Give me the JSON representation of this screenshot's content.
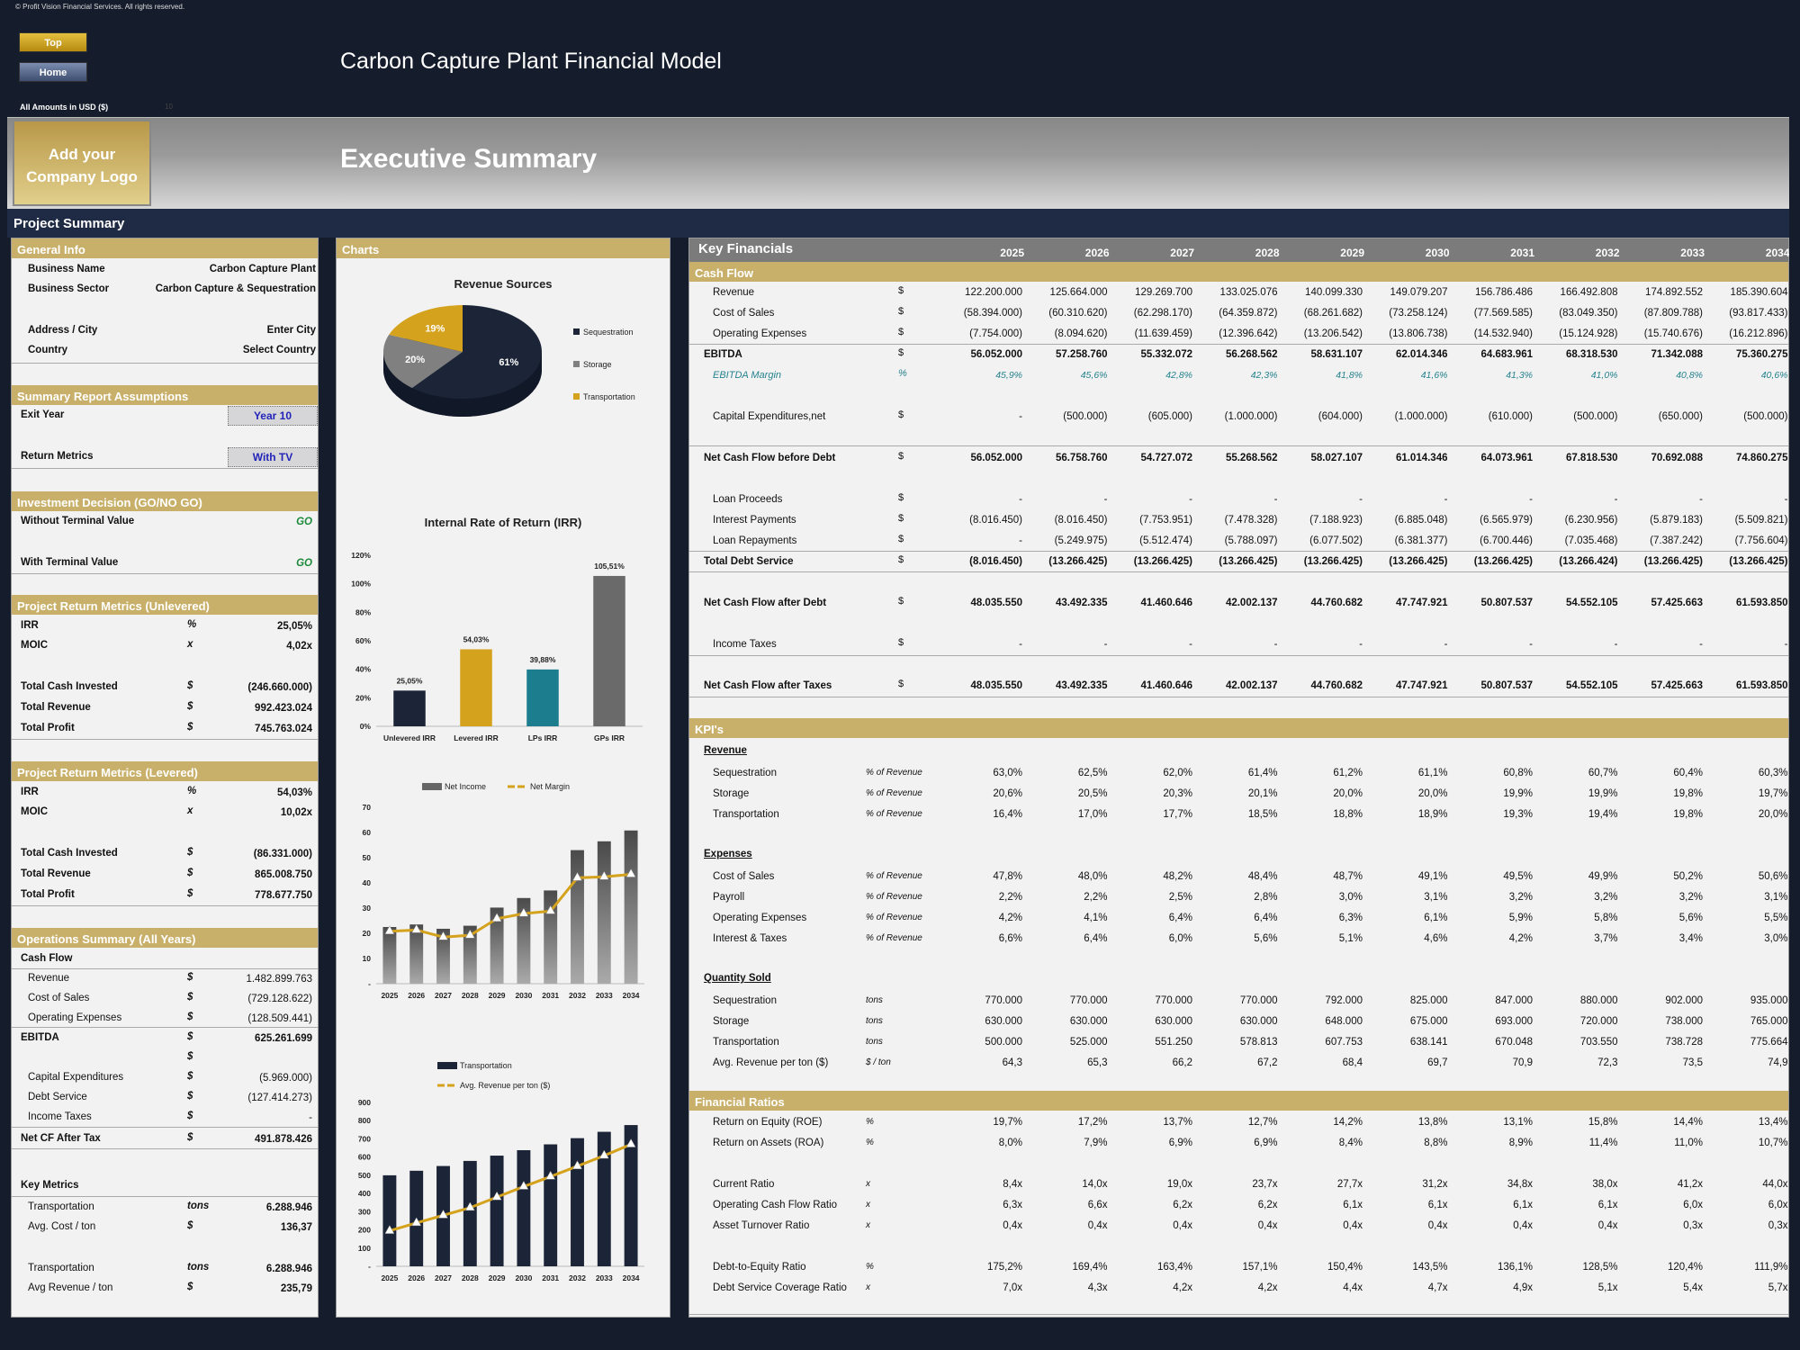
{
  "copyright": "© Profit Vision Financial Services. All rights reserved.",
  "nav": {
    "top_label": "Top",
    "home_label": "Home"
  },
  "app_title": "Carbon Capture Plant Financial Model",
  "amounts_label": "All Amounts in   USD ($)",
  "amounts_faint": "10",
  "logo_text": "Add your Company Logo",
  "page_title": "Executive Summary",
  "project_summary_label": "Project Summary",
  "general_info": {
    "title": "General Info",
    "rows": [
      {
        "label": "Business Name",
        "value": "Carbon Capture Plant"
      },
      {
        "label": "Business Sector",
        "value": "Carbon Capture & Sequestration"
      },
      {
        "label": "Address / City",
        "value": "Enter City"
      },
      {
        "label": "Country",
        "value": "Select Country"
      }
    ]
  },
  "assumptions": {
    "title": "Summary  Report Assumptions",
    "exit_year_label": "Exit Year",
    "exit_year_value": "Year 10",
    "return_metrics_label": "Return Metrics",
    "return_metrics_value": "With TV"
  },
  "investment_decision": {
    "title": "Investment Decision (GO/NO GO)",
    "without_tv_label": "Without Terminal Value",
    "without_tv_value": "GO",
    "with_tv_label": "With Terminal Value",
    "with_tv_value": "GO"
  },
  "unlevered": {
    "title": "Project Return Metrics (Unlevered)",
    "rows": [
      {
        "label": "IRR",
        "unit": "%",
        "value": "25,05%"
      },
      {
        "label": "MOIC",
        "unit": "x",
        "value": "4,02x"
      },
      {
        "label": "Total Cash Invested",
        "unit": "$",
        "value": "(246.660.000)"
      },
      {
        "label": "Total Revenue",
        "unit": "$",
        "value": "992.423.024"
      },
      {
        "label": "Total Profit",
        "unit": "$",
        "value": "745.763.024"
      }
    ]
  },
  "levered": {
    "title": "Project Return Metrics (Levered)",
    "rows": [
      {
        "label": "IRR",
        "unit": "%",
        "value": "54,03%"
      },
      {
        "label": "MOIC",
        "unit": "x",
        "value": "10,02x"
      },
      {
        "label": "Total Cash Invested",
        "unit": "$",
        "value": "(86.331.000)"
      },
      {
        "label": "Total Revenue",
        "unit": "$",
        "value": "865.008.750"
      },
      {
        "label": "Total Profit",
        "unit": "$",
        "value": "778.677.750"
      }
    ]
  },
  "operations": {
    "title": "Operations Summary (All Years)",
    "cash_flow_label": "Cash Flow",
    "rows": [
      {
        "label": "Revenue",
        "unit": "$",
        "value": "1.482.899.763"
      },
      {
        "label": "Cost of Sales",
        "unit": "$",
        "value": "(729.128.622)"
      },
      {
        "label": "Operating Expenses",
        "unit": "$",
        "value": "(128.509.441)"
      },
      {
        "label": "EBITDA",
        "unit": "$",
        "value": "625.261.699"
      },
      {
        "label": "",
        "unit": "$",
        "value": ""
      },
      {
        "label": "Capital Expenditures",
        "unit": "$",
        "value": "(5.969.000)"
      },
      {
        "label": "Debt Service",
        "unit": "$",
        "value": "(127.414.273)"
      },
      {
        "label": "Income Taxes",
        "unit": "$",
        "value": "-"
      },
      {
        "label": "Net CF After Tax",
        "unit": "$",
        "value": "491.878.426"
      }
    ],
    "key_metrics_label": "Key Metrics",
    "key_metrics": [
      {
        "label": "Transportation",
        "unit": "tons",
        "value": "6.288.946"
      },
      {
        "label": "Avg. Cost / ton",
        "unit": "$",
        "value": "136,37"
      },
      {
        "label": "Transportation",
        "unit": "tons",
        "value": "6.288.946"
      },
      {
        "label": "Avg Revenue / ton",
        "unit": "$",
        "value": "235,79"
      }
    ]
  },
  "charts_title": "Charts",
  "chart_data": [
    {
      "type": "pie",
      "title": "Revenue Sources",
      "categories": [
        "Sequestration",
        "Storage",
        "Transportation"
      ],
      "values": [
        61,
        20,
        19
      ],
      "labels": [
        "61%",
        "20%",
        "19%"
      ],
      "colors": [
        "#1c2537",
        "#808080",
        "#d4a21c"
      ],
      "legend": "right"
    },
    {
      "type": "bar",
      "title": "Internal Rate of Return (IRR)",
      "categories": [
        "Unlevered IRR",
        "Levered IRR",
        "LPs IRR",
        "GPs IRR"
      ],
      "values": [
        25.05,
        54.03,
        39.88,
        105.51
      ],
      "labels": [
        "25,05%",
        "54,03%",
        "39,88%",
        "105,51%"
      ],
      "colors": [
        "#1c2537",
        "#d4a21c",
        "#1b7d8e",
        "#6a6a6a"
      ],
      "ylim": [
        0,
        120
      ],
      "yticks": [
        "0%",
        "20%",
        "40%",
        "60%",
        "80%",
        "100%",
        "120%"
      ]
    },
    {
      "type": "bar+line",
      "title": "",
      "categories": [
        "2025",
        "2026",
        "2027",
        "2028",
        "2029",
        "2030",
        "2031",
        "2032",
        "2033",
        "2034"
      ],
      "series": [
        {
          "name": "Net Income",
          "type": "bar",
          "values": [
            22.5,
            23.5,
            21.8,
            23.0,
            30.2,
            34.0,
            37.0,
            53.0,
            56.5,
            60.8
          ]
        },
        {
          "name": "Net Margin",
          "type": "line",
          "values": [
            20.8,
            21.3,
            18.5,
            19.2,
            25.8,
            27.8,
            28.8,
            42.0,
            42.4,
            43.4
          ]
        }
      ],
      "ylim": [
        0,
        70
      ],
      "yticks": [
        "-",
        "10",
        "20",
        "30",
        "40",
        "50",
        "60",
        "70"
      ],
      "legend": "top"
    },
    {
      "type": "bar+line",
      "title": "",
      "categories": [
        "2025",
        "2026",
        "2027",
        "2028",
        "2029",
        "2030",
        "2031",
        "2032",
        "2033",
        "2034"
      ],
      "series": [
        {
          "name": "Transportation",
          "type": "bar",
          "values": [
            500,
            525,
            551,
            579,
            608,
            638,
            670,
            704,
            739,
            776
          ]
        },
        {
          "name": "Avg. Revenue per ton ($)",
          "type": "line",
          "values": [
            195,
            238,
            280,
            322,
            380,
            438,
            493,
            550,
            608,
            670
          ]
        }
      ],
      "ylim": [
        0,
        900
      ],
      "yticks": [
        "-",
        "100",
        "200",
        "300",
        "400",
        "500",
        "600",
        "700",
        "800",
        "900"
      ],
      "legend": "top"
    }
  ],
  "key_financials": {
    "title": "Key Financials",
    "years": [
      "2025",
      "2026",
      "2027",
      "2028",
      "2029",
      "2030",
      "2031",
      "2032",
      "2033",
      "2034"
    ],
    "cash_flow_title": "Cash Flow",
    "cash_flow_rows": [
      {
        "label": "Revenue",
        "unit": "$",
        "style": "ind",
        "values": [
          "122.200.000",
          "125.664.000",
          "129.269.700",
          "133.025.076",
          "140.099.330",
          "149.079.207",
          "156.786.486",
          "166.492.808",
          "174.892.552",
          "185.390.604"
        ]
      },
      {
        "label": "Cost of Sales",
        "unit": "$",
        "style": "ind",
        "values": [
          "(58.394.000)",
          "(60.310.620)",
          "(62.298.170)",
          "(64.359.872)",
          "(68.261.682)",
          "(73.258.124)",
          "(77.569.585)",
          "(83.049.350)",
          "(87.809.788)",
          "(93.817.433)"
        ]
      },
      {
        "label": "Operating Expenses",
        "unit": "$",
        "style": "ind",
        "values": [
          "(7.754.000)",
          "(8.094.620)",
          "(11.639.459)",
          "(12.396.642)",
          "(13.206.542)",
          "(13.806.738)",
          "(14.532.940)",
          "(15.124.928)",
          "(15.740.676)",
          "(16.212.896)"
        ]
      },
      {
        "label": "EBITDA",
        "unit": "$",
        "style": "bold",
        "values": [
          "56.052.000",
          "57.258.760",
          "55.332.072",
          "56.268.562",
          "58.631.107",
          "62.014.346",
          "64.683.961",
          "68.318.530",
          "71.342.088",
          "75.360.275"
        ]
      },
      {
        "label": "EBITDA Margin",
        "unit": "%",
        "style": "margin",
        "values": [
          "45,9%",
          "45,6%",
          "42,8%",
          "42,3%",
          "41,8%",
          "41,6%",
          "41,3%",
          "41,0%",
          "40,8%",
          "40,6%"
        ]
      },
      {
        "label": "Capital Expenditures,net",
        "unit": "$",
        "style": "ind",
        "values": [
          "-",
          "(500.000)",
          "(605.000)",
          "(1.000.000)",
          "(604.000)",
          "(1.000.000)",
          "(610.000)",
          "(500.000)",
          "(650.000)",
          "(500.000)"
        ]
      },
      {
        "label": "Net Cash Flow before Debt",
        "unit": "$",
        "style": "bold",
        "values": [
          "56.052.000",
          "56.758.760",
          "54.727.072",
          "55.268.562",
          "58.027.107",
          "61.014.346",
          "64.073.961",
          "67.818.530",
          "70.692.088",
          "74.860.275"
        ]
      },
      {
        "label": "Loan Proceeds",
        "unit": "$",
        "style": "ind",
        "values": [
          "-",
          "-",
          "-",
          "-",
          "-",
          "-",
          "-",
          "-",
          "-",
          "-"
        ]
      },
      {
        "label": "Interest Payments",
        "unit": "$",
        "style": "ind",
        "values": [
          "(8.016.450)",
          "(8.016.450)",
          "(7.753.951)",
          "(7.478.328)",
          "(7.188.923)",
          "(6.885.048)",
          "(6.565.979)",
          "(6.230.956)",
          "(5.879.183)",
          "(5.509.821)"
        ]
      },
      {
        "label": "Loan Repayments",
        "unit": "$",
        "style": "ind",
        "values": [
          "-",
          "(5.249.975)",
          "(5.512.474)",
          "(5.788.097)",
          "(6.077.502)",
          "(6.381.377)",
          "(6.700.446)",
          "(7.035.468)",
          "(7.387.242)",
          "(7.756.604)"
        ]
      },
      {
        "label": "Total Debt Service",
        "unit": "$",
        "style": "bold",
        "values": [
          "(8.016.450)",
          "(13.266.425)",
          "(13.266.425)",
          "(13.266.425)",
          "(13.266.425)",
          "(13.266.425)",
          "(13.266.425)",
          "(13.266.424)",
          "(13.266.425)",
          "(13.266.425)"
        ]
      },
      {
        "label": "Net Cash Flow after Debt",
        "unit": "$",
        "style": "bold",
        "values": [
          "48.035.550",
          "43.492.335",
          "41.460.646",
          "42.002.137",
          "44.760.682",
          "47.747.921",
          "50.807.537",
          "54.552.105",
          "57.425.663",
          "61.593.850"
        ]
      },
      {
        "label": "Income Taxes",
        "unit": "$",
        "style": "ind",
        "values": [
          "-",
          "-",
          "-",
          "-",
          "-",
          "-",
          "-",
          "-",
          "-",
          "-"
        ]
      },
      {
        "label": "Net Cash Flow after Taxes",
        "unit": "$",
        "style": "bold",
        "values": [
          "48.035.550",
          "43.492.335",
          "41.460.646",
          "42.002.137",
          "44.760.682",
          "47.747.921",
          "50.807.537",
          "54.552.105",
          "57.425.663",
          "61.593.850"
        ]
      }
    ],
    "kpi_title": "KPI's",
    "kpi_revenue_label": "Revenue",
    "kpi_revenue": [
      {
        "label": "Sequestration",
        "unit": "% of Revenue",
        "values": [
          "63,0%",
          "62,5%",
          "62,0%",
          "61,4%",
          "61,2%",
          "61,1%",
          "60,8%",
          "60,7%",
          "60,4%",
          "60,3%"
        ]
      },
      {
        "label": "Storage",
        "unit": "% of Revenue",
        "values": [
          "20,6%",
          "20,5%",
          "20,3%",
          "20,1%",
          "20,0%",
          "20,0%",
          "19,9%",
          "19,9%",
          "19,8%",
          "19,7%"
        ]
      },
      {
        "label": "Transportation",
        "unit": "% of Revenue",
        "values": [
          "16,4%",
          "17,0%",
          "17,7%",
          "18,5%",
          "18,8%",
          "18,9%",
          "19,3%",
          "19,4%",
          "19,8%",
          "20,0%"
        ]
      }
    ],
    "kpi_expenses_label": "Expenses",
    "kpi_expenses": [
      {
        "label": "Cost of Sales",
        "unit": "% of Revenue",
        "values": [
          "47,8%",
          "48,0%",
          "48,2%",
          "48,4%",
          "48,7%",
          "49,1%",
          "49,5%",
          "49,9%",
          "50,2%",
          "50,6%"
        ]
      },
      {
        "label": "Payroll",
        "unit": "% of Revenue",
        "values": [
          "2,2%",
          "2,2%",
          "2,5%",
          "2,8%",
          "3,0%",
          "3,1%",
          "3,2%",
          "3,2%",
          "3,2%",
          "3,1%"
        ]
      },
      {
        "label": "Operating Expenses",
        "unit": "% of Revenue",
        "values": [
          "4,2%",
          "4,1%",
          "6,4%",
          "6,4%",
          "6,3%",
          "6,1%",
          "5,9%",
          "5,8%",
          "5,6%",
          "5,5%"
        ]
      },
      {
        "label": "Interest & Taxes",
        "unit": "% of Revenue",
        "values": [
          "6,6%",
          "6,4%",
          "6,0%",
          "5,6%",
          "5,1%",
          "4,6%",
          "4,2%",
          "3,7%",
          "3,4%",
          "3,0%"
        ]
      }
    ],
    "kpi_quantity_label": "Quantity Sold",
    "kpi_quantity": [
      {
        "label": "Sequestration",
        "unit": "tons",
        "values": [
          "770.000",
          "770.000",
          "770.000",
          "770.000",
          "792.000",
          "825.000",
          "847.000",
          "880.000",
          "902.000",
          "935.000"
        ]
      },
      {
        "label": "Storage",
        "unit": "tons",
        "values": [
          "630.000",
          "630.000",
          "630.000",
          "630.000",
          "648.000",
          "675.000",
          "693.000",
          "720.000",
          "738.000",
          "765.000"
        ]
      },
      {
        "label": "Transportation",
        "unit": "tons",
        "values": [
          "500.000",
          "525.000",
          "551.250",
          "578.813",
          "607.753",
          "638.141",
          "670.048",
          "703.550",
          "738.728",
          "775.664"
        ]
      },
      {
        "label": "Avg. Revenue per ton ($)",
        "unit": "$ / ton",
        "values": [
          "64,3",
          "65,3",
          "66,2",
          "67,2",
          "68,4",
          "69,7",
          "70,9",
          "72,3",
          "73,5",
          "74,9"
        ]
      }
    ],
    "ratios_title": "Financial Ratios",
    "ratios": [
      {
        "label": "Return on Equity (ROE)",
        "unit": "%",
        "values": [
          "19,7%",
          "17,2%",
          "13,7%",
          "12,7%",
          "14,2%",
          "13,8%",
          "13,1%",
          "15,8%",
          "14,4%",
          "13,4%"
        ]
      },
      {
        "label": "Return on Assets (ROA)",
        "unit": "%",
        "values": [
          "8,0%",
          "7,9%",
          "6,9%",
          "6,9%",
          "8,4%",
          "8,8%",
          "8,9%",
          "11,4%",
          "11,0%",
          "10,7%"
        ]
      },
      {
        "label": "Current Ratio",
        "unit": "x",
        "values": [
          "8,4x",
          "14,0x",
          "19,0x",
          "23,7x",
          "27,7x",
          "31,2x",
          "34,8x",
          "38,0x",
          "41,2x",
          "44,0x"
        ]
      },
      {
        "label": "Operating Cash Flow Ratio",
        "unit": "x",
        "values": [
          "6,3x",
          "6,6x",
          "6,2x",
          "6,2x",
          "6,1x",
          "6,1x",
          "6,1x",
          "6,1x",
          "6,0x",
          "6,0x"
        ]
      },
      {
        "label": "Asset Turnover Ratio",
        "unit": "x",
        "values": [
          "0,4x",
          "0,4x",
          "0,4x",
          "0,4x",
          "0,4x",
          "0,4x",
          "0,4x",
          "0,4x",
          "0,3x",
          "0,3x"
        ]
      },
      {
        "label": "Debt-to-Equity Ratio",
        "unit": "%",
        "values": [
          "175,2%",
          "169,4%",
          "163,4%",
          "157,1%",
          "150,4%",
          "143,5%",
          "136,1%",
          "128,5%",
          "120,4%",
          "111,9%"
        ]
      },
      {
        "label": "Debt Service Coverage Ratio",
        "unit": "x",
        "values": [
          "7,0x",
          "4,3x",
          "4,2x",
          "4,2x",
          "4,4x",
          "4,7x",
          "4,9x",
          "5,1x",
          "5,4x",
          "5,7x"
        ]
      }
    ]
  }
}
